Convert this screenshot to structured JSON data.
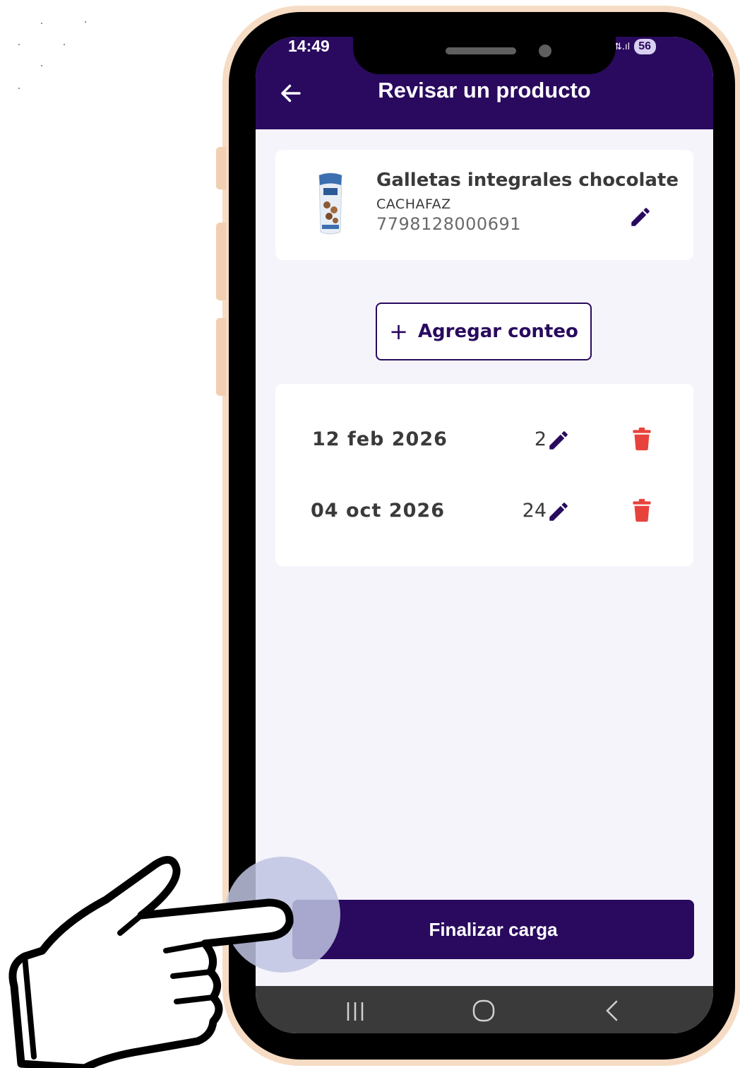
{
  "status_bar": {
    "time": "14:49",
    "signal": "56 .ıl",
    "battery": "56"
  },
  "header": {
    "title": "Revisar un producto"
  },
  "product": {
    "name": "Galletas integrales chocolate",
    "brand": "CACHAFAZ",
    "code": "7798128000691"
  },
  "actions": {
    "add_count_label": "Agregar conteo",
    "add_count_icon": "plus",
    "finish_label": "Finalizar carga"
  },
  "counts": [
    {
      "date": "12 feb 2026",
      "quantity": "2"
    },
    {
      "date": "04 oct 2026",
      "quantity": "24"
    }
  ],
  "colors": {
    "primary": "#290a5e",
    "danger": "#e8423c",
    "background": "#f5f4fb",
    "navbar": "#3a3a3a"
  },
  "icons": [
    "arrow-left-icon",
    "pencil-icon",
    "trash-icon",
    "recent-apps-icon",
    "home-icon",
    "back-chevron-icon",
    "pointing-hand-icon"
  ]
}
